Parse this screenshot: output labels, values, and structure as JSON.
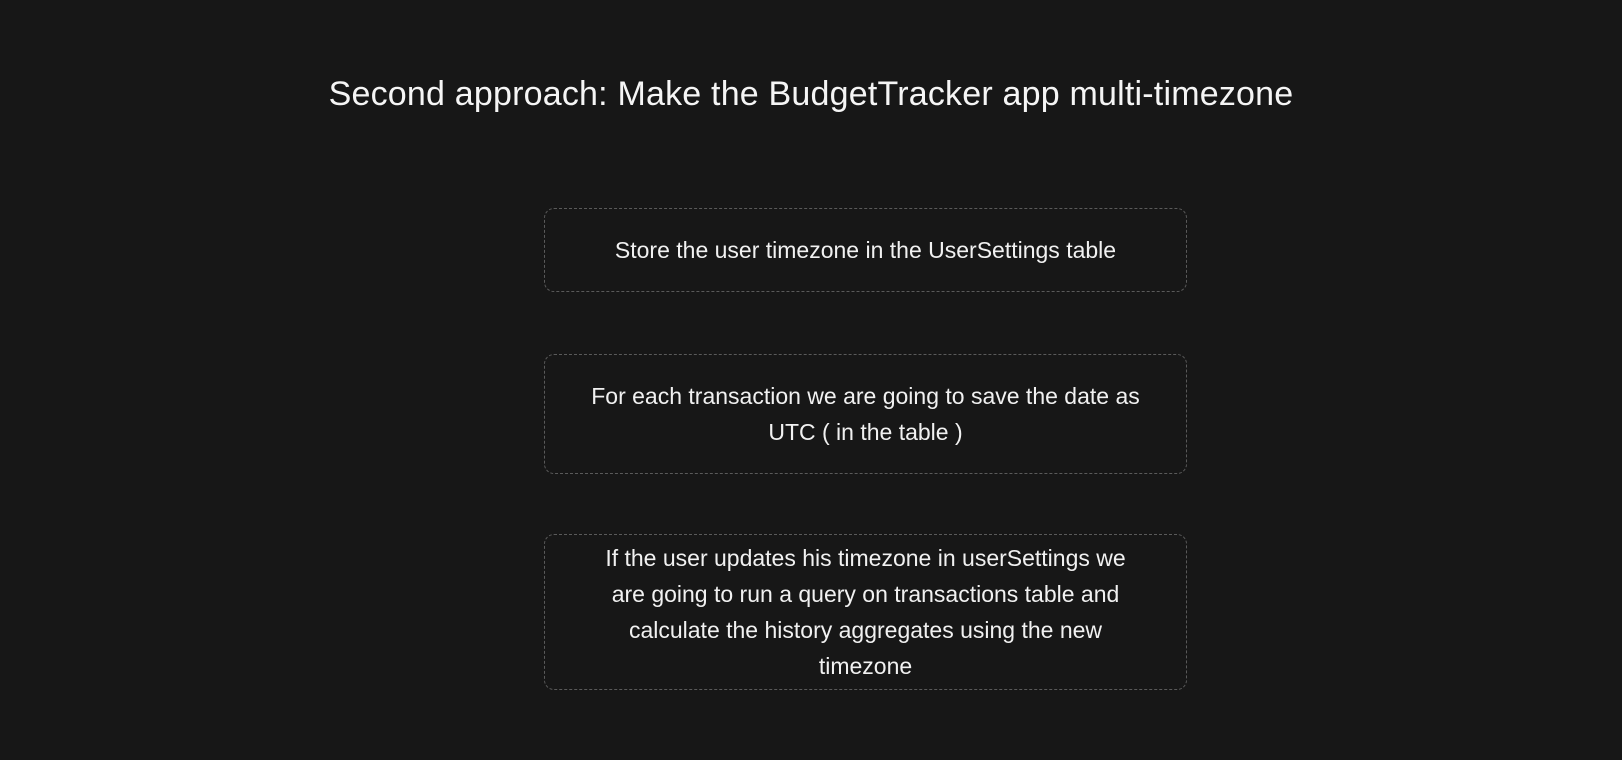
{
  "slide": {
    "title": "Second approach: Make the BudgetTracker app multi-timezone",
    "steps": [
      {
        "text": "Store the user timezone in the UserSettings table"
      },
      {
        "line1": "For each transaction we are going to save the date as",
        "line2": "UTC ( in the table )"
      },
      {
        "line1": "If the user updates his timezone in userSettings we",
        "line2": "are going to run a query on transactions table and",
        "line3": "calculate the history aggregates using the new",
        "line4": "timezone"
      }
    ]
  },
  "colors": {
    "background": "#171717",
    "text": "#f2f2f2",
    "dashed_border": "#5a5a5a"
  }
}
